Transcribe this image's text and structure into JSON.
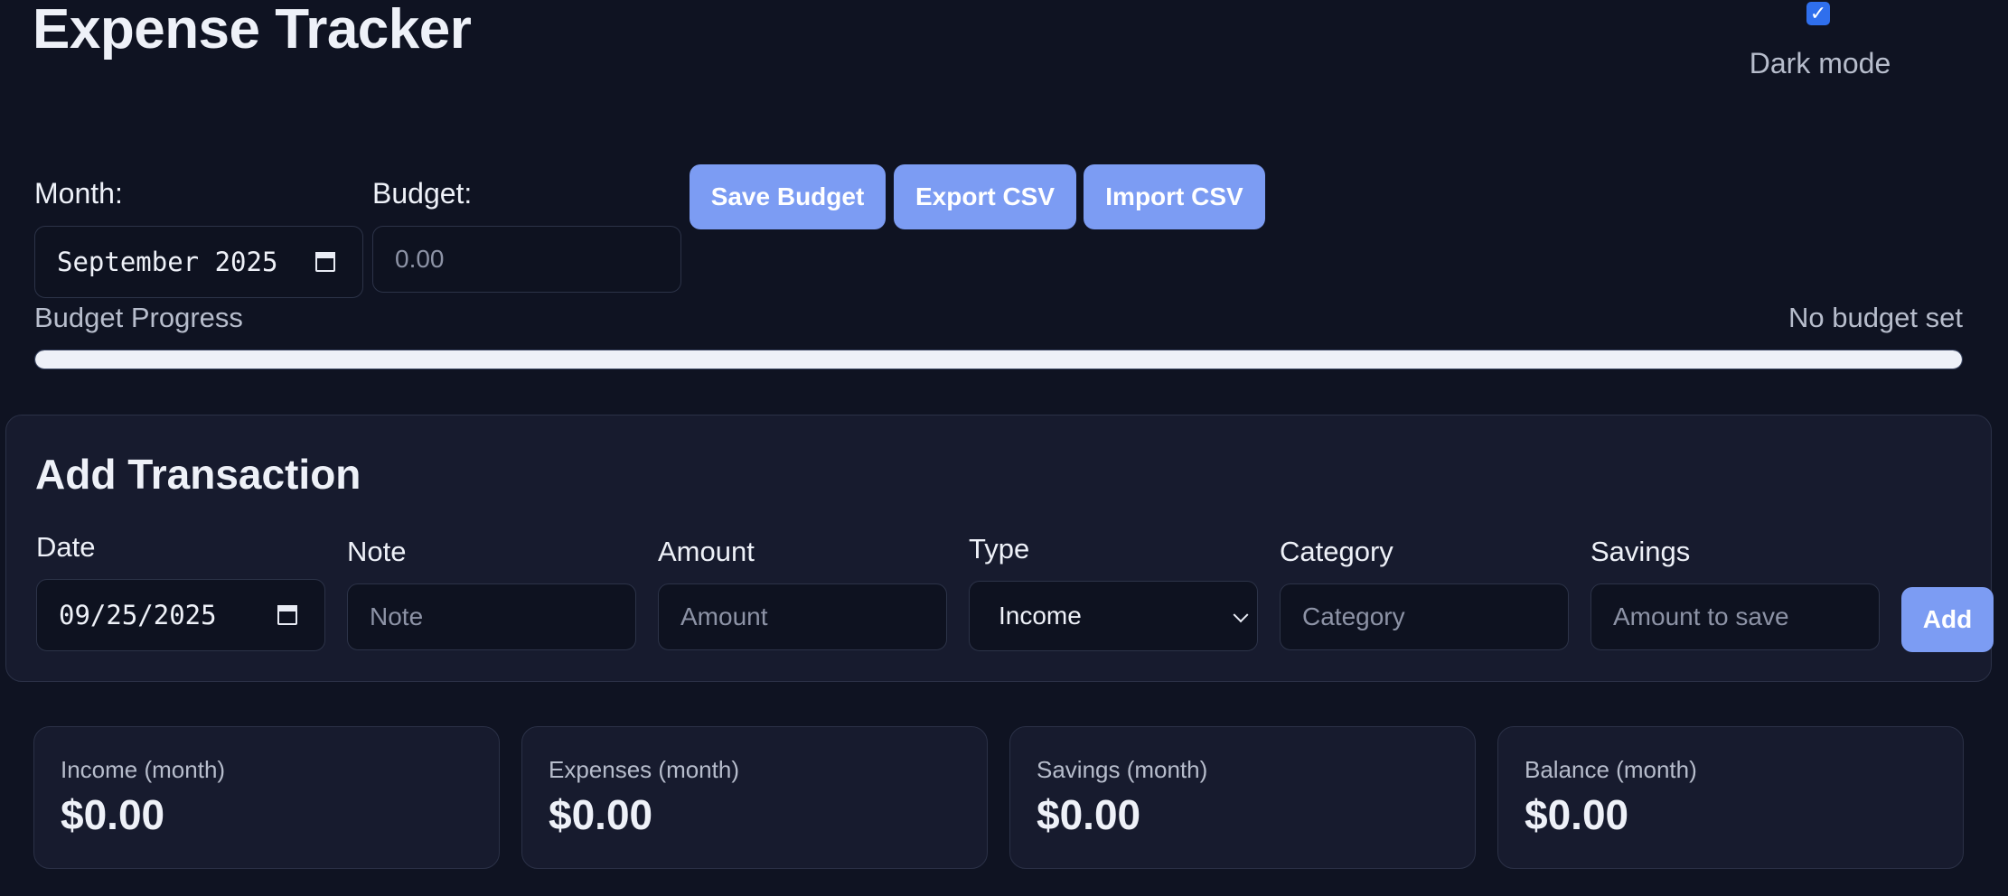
{
  "header": {
    "title": "Expense Tracker",
    "dark_mode_label": "Dark mode",
    "dark_mode_checked": true
  },
  "budget_bar": {
    "month_label": "Month:",
    "month_value": "September 2025",
    "budget_label": "Budget:",
    "budget_placeholder": "0.00",
    "save_budget": "Save Budget",
    "export_csv": "Export CSV",
    "import_csv": "Import CSV"
  },
  "progress": {
    "label": "Budget Progress",
    "status": "No budget set",
    "fill_fraction": 1.0
  },
  "add_transaction": {
    "title": "Add Transaction",
    "date_label": "Date",
    "date_value": "09/25/2025",
    "note_label": "Note",
    "note_placeholder": "Note",
    "amount_label": "Amount",
    "amount_placeholder": "Amount",
    "type_label": "Type",
    "type_value": "Income",
    "category_label": "Category",
    "category_placeholder": "Category",
    "savings_label": "Savings",
    "savings_placeholder": "Amount to save",
    "add_button": "Add"
  },
  "stats": [
    {
      "label": "Income (month)",
      "value": "$0.00"
    },
    {
      "label": "Expenses (month)",
      "value": "$0.00"
    },
    {
      "label": "Savings (month)",
      "value": "$0.00"
    },
    {
      "label": "Balance (month)",
      "value": "$0.00"
    }
  ],
  "colors": {
    "background": "#0f1322",
    "card": "#171b2e",
    "accent_button": "#7c9cf3",
    "checkbox": "#2f6fed"
  }
}
